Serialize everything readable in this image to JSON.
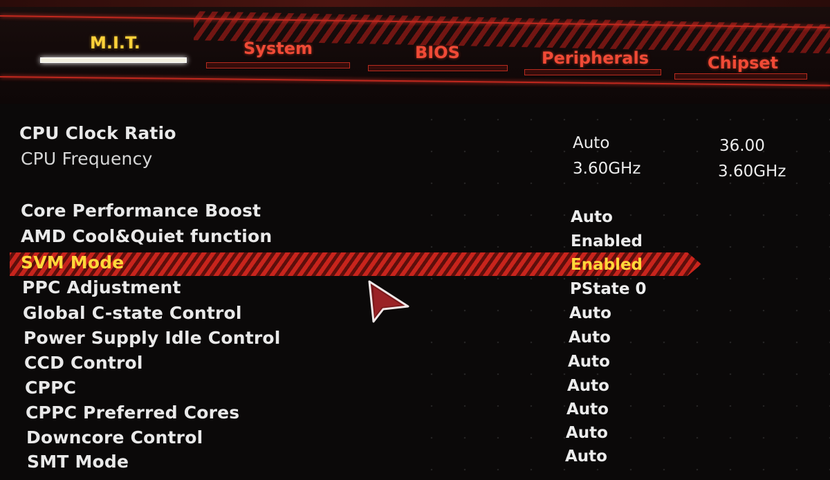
{
  "tabs": [
    {
      "label": "M.I.T.",
      "active": true
    },
    {
      "label": "System",
      "active": false
    },
    {
      "label": "BIOS",
      "active": false
    },
    {
      "label": "Peripherals",
      "active": false
    },
    {
      "label": "Chipset",
      "active": false
    }
  ],
  "settings": [
    {
      "label": "CPU Clock Ratio",
      "value": "Auto",
      "value2": "36.00"
    },
    {
      "label": "CPU Frequency",
      "value": "3.60GHz",
      "value2": "3.60GHz"
    },
    {
      "label": "Core Performance Boost",
      "value": "Auto"
    },
    {
      "label": "AMD Cool&Quiet function",
      "value": "Enabled"
    },
    {
      "label": "SVM Mode",
      "value": "Enabled",
      "selected": true
    },
    {
      "label": "PPC Adjustment",
      "value": "PState 0"
    },
    {
      "label": "Global C-state Control",
      "value": "Auto"
    },
    {
      "label": "Power Supply Idle Control",
      "value": "Auto"
    },
    {
      "label": "CCD Control",
      "value": "Auto"
    },
    {
      "label": "CPPC",
      "value": "Auto"
    },
    {
      "label": "CPPC Preferred Cores",
      "value": "Auto"
    },
    {
      "label": "Downcore Control",
      "value": "Auto"
    },
    {
      "label": "SMT Mode",
      "value": "Auto"
    }
  ],
  "colors": {
    "accent_red": "#c0281e",
    "active_tab": "#ffd23a",
    "tab_text": "#f04a36",
    "selected_text": "#ffd83a"
  },
  "icons": {
    "cursor": "mouse-pointer-icon"
  }
}
